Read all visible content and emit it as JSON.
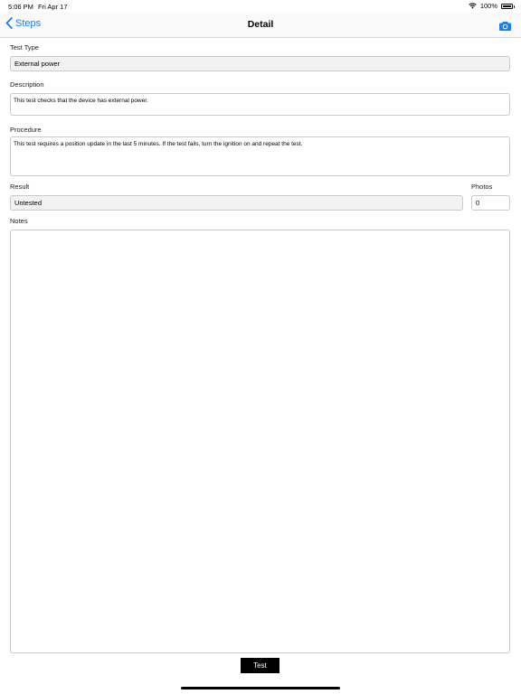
{
  "status_bar": {
    "time": "5:06 PM",
    "date": "Fri Apr 17",
    "battery": "100%"
  },
  "nav": {
    "back_label": "Steps",
    "title": "Detail"
  },
  "form": {
    "test_type_label": "Test Type",
    "test_type_value": "External power",
    "description_label": "Description",
    "description_value": "This test checks that the device has external power.",
    "procedure_label": "Procedure",
    "procedure_value": "This test requires a position update in the last 5 minutes. If the test fails, turn the ignition on and repeat the test.",
    "result_label": "Result",
    "result_value": "Untested",
    "photos_label": "Photos",
    "photos_value": "0",
    "notes_label": "Notes",
    "notes_value": ""
  },
  "actions": {
    "test_label": "Test"
  },
  "colors": {
    "accent": "#147efb"
  }
}
